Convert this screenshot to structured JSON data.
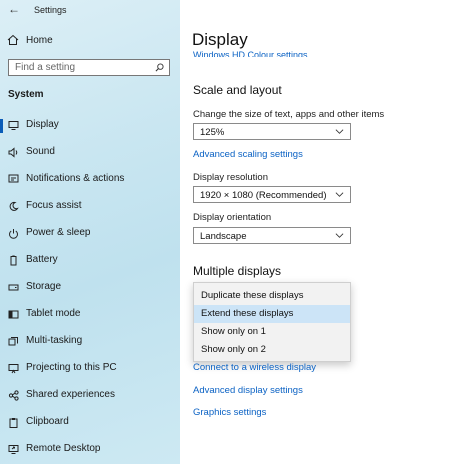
{
  "app": {
    "title": "Settings"
  },
  "sidebar": {
    "home": "Home",
    "search_placeholder": "Find a setting",
    "section": "System",
    "items": [
      {
        "label": "Display",
        "icon": "monitor-icon",
        "active": true
      },
      {
        "label": "Sound",
        "icon": "speaker-icon"
      },
      {
        "label": "Notifications & actions",
        "icon": "notification-icon"
      },
      {
        "label": "Focus assist",
        "icon": "moon-icon"
      },
      {
        "label": "Power & sleep",
        "icon": "power-icon"
      },
      {
        "label": "Battery",
        "icon": "battery-icon"
      },
      {
        "label": "Storage",
        "icon": "storage-icon"
      },
      {
        "label": "Tablet mode",
        "icon": "tablet-icon"
      },
      {
        "label": "Multi-tasking",
        "icon": "multitask-icon"
      },
      {
        "label": "Projecting to this PC",
        "icon": "projector-icon"
      },
      {
        "label": "Shared experiences",
        "icon": "shared-icon"
      },
      {
        "label": "Clipboard",
        "icon": "clipboard-icon"
      },
      {
        "label": "Remote Desktop",
        "icon": "remote-icon"
      }
    ]
  },
  "main": {
    "title": "Display",
    "clipped_link": "Windows HD Colour settings",
    "scale_section": "Scale and layout",
    "scale_label": "Change the size of text, apps and other items",
    "scale_value": "125%",
    "advanced_scaling": "Advanced scaling settings",
    "resolution_label": "Display resolution",
    "resolution_value": "1920 × 1080 (Recommended)",
    "orientation_label": "Display orientation",
    "orientation_value": "Landscape",
    "multiple_section": "Multiple displays",
    "multiple_options": [
      {
        "label": "Duplicate these displays"
      },
      {
        "label": "Extend these displays",
        "highlighted": true
      },
      {
        "label": "Show only on 1"
      },
      {
        "label": "Show only on 2"
      }
    ],
    "wireless_link": "Connect to a wireless display",
    "advanced_display": "Advanced display settings",
    "graphics": "Graphics settings"
  },
  "colors": {
    "accent": "#0a5cb8",
    "link": "#0b62c4",
    "highlight": "#cce4f7"
  }
}
